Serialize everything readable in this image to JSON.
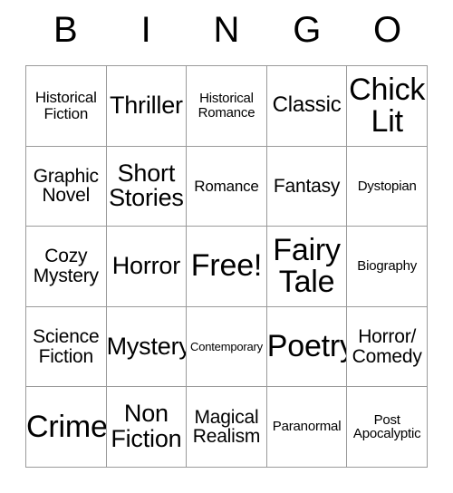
{
  "card": {
    "header_letters": [
      "B",
      "I",
      "N",
      "G",
      "O"
    ],
    "rows": [
      [
        {
          "label": "Historical\nFiction",
          "size": "s"
        },
        {
          "label": "Thriller",
          "size": "xl"
        },
        {
          "label": "Historical\nRomance",
          "size": "xs"
        },
        {
          "label": "Classic",
          "size": "l"
        },
        {
          "label": "Chick\nLit",
          "size": "xxl"
        }
      ],
      [
        {
          "label": "Graphic\nNovel",
          "size": "m"
        },
        {
          "label": "Short\nStories",
          "size": "xl"
        },
        {
          "label": "Romance",
          "size": "s"
        },
        {
          "label": "Fantasy",
          "size": "m"
        },
        {
          "label": "Dystopian",
          "size": "xs"
        }
      ],
      [
        {
          "label": "Cozy\nMystery",
          "size": "m"
        },
        {
          "label": "Horror",
          "size": "xl"
        },
        {
          "label": "Free!",
          "size": "xxl"
        },
        {
          "label": "Fairy\nTale",
          "size": "xxl"
        },
        {
          "label": "Biography",
          "size": "xs"
        }
      ],
      [
        {
          "label": "Science\nFiction",
          "size": "m"
        },
        {
          "label": "Mystery",
          "size": "xl"
        },
        {
          "label": "Contemporary",
          "size": "xxs"
        },
        {
          "label": "Poetry",
          "size": "xxl"
        },
        {
          "label": "Horror/\nComedy",
          "size": "m"
        }
      ],
      [
        {
          "label": "Crime",
          "size": "xxl"
        },
        {
          "label": "Non\nFiction",
          "size": "xl"
        },
        {
          "label": "Magical\nRealism",
          "size": "m"
        },
        {
          "label": "Paranormal",
          "size": "xs"
        },
        {
          "label": "Post\nApocalyptic",
          "size": "xs"
        }
      ]
    ]
  }
}
